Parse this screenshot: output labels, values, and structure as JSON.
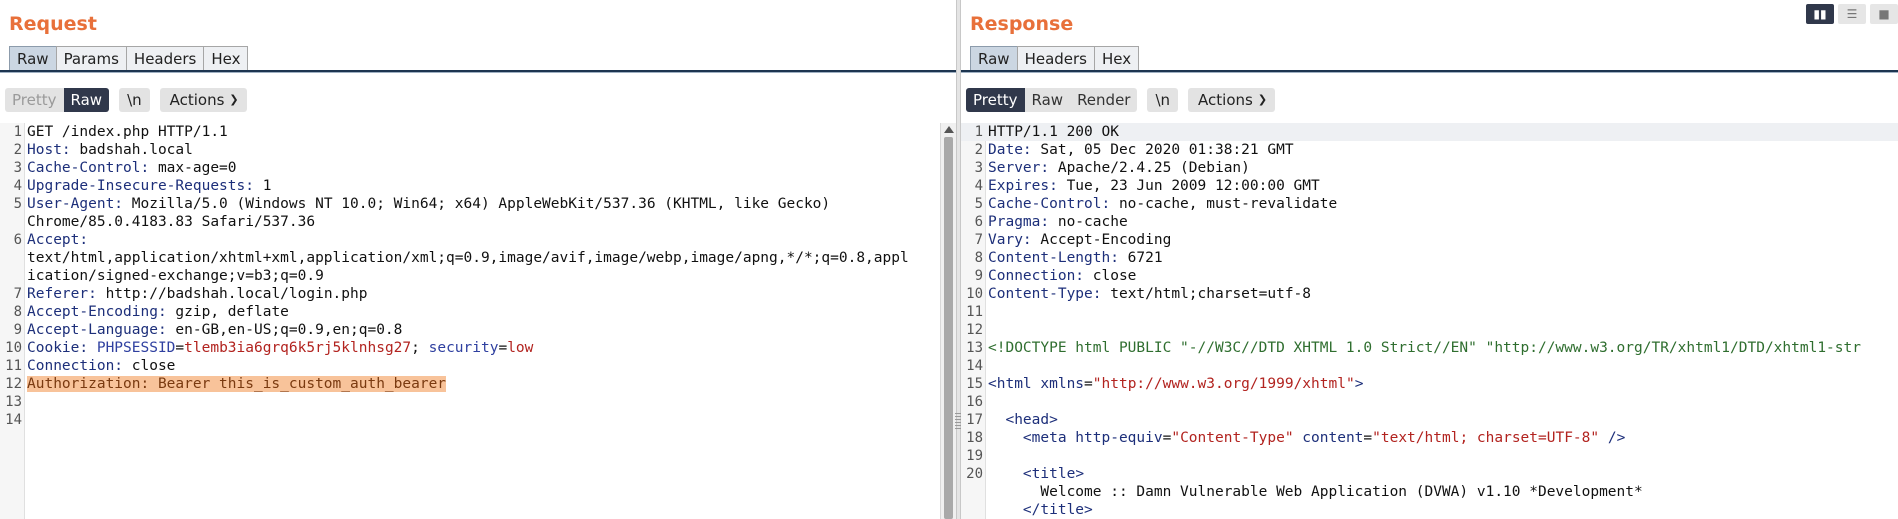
{
  "request": {
    "title": "Request",
    "tabs": [
      "Raw",
      "Params",
      "Headers",
      "Hex"
    ],
    "active_tab": "Raw",
    "view_modes": [
      "Pretty",
      "Raw"
    ],
    "newline_label": "\\n",
    "actions_label": "Actions",
    "lines": [
      {
        "n": "1",
        "a": "GET /index.php HTTP/1.1"
      },
      {
        "n": "2",
        "k": "Host:",
        "v": " badshah.local"
      },
      {
        "n": "3",
        "k": "Cache-Control:",
        "v": " max-age=0"
      },
      {
        "n": "4",
        "k": "Upgrade-Insecure-Requests:",
        "v": " 1"
      },
      {
        "n": "5",
        "k": "User-Agent:",
        "v": " Mozilla/5.0 (Windows NT 10.0; Win64; x64) AppleWebKit/537.36 (KHTML, like Gecko)"
      },
      {
        "n": "",
        "a": "Chrome/85.0.4183.83 Safari/537.36"
      },
      {
        "n": "6",
        "k": "Accept:",
        "v": ""
      },
      {
        "n": "",
        "a": "text/html,application/xhtml+xml,application/xml;q=0.9,image/avif,image/webp,image/apng,*/*;q=0.8,appl"
      },
      {
        "n": "",
        "a": "ication/signed-exchange;v=b3;q=0.9"
      },
      {
        "n": "7",
        "k": "Referer:",
        "v": " http://badshah.local/login.php"
      },
      {
        "n": "8",
        "k": "Accept-Encoding:",
        "v": " gzip, deflate"
      },
      {
        "n": "9",
        "k": "Accept-Language:",
        "v": " en-GB,en-US;q=0.9,en;q=0.8"
      },
      {
        "n": "10",
        "k": "Cookie:",
        "c1k": " PHPSESSID",
        "eq1": "=",
        "c1v": "tlemb3ia6grq6k5rj5klnhsg27",
        "sep": "; ",
        "c2k": "security",
        "eq2": "=",
        "c2v": "low"
      },
      {
        "n": "11",
        "k": "Connection:",
        "v": " close"
      },
      {
        "n": "12",
        "h": "Authorization: Bearer this_is_custom_auth_bearer"
      },
      {
        "n": "13",
        "a": ""
      },
      {
        "n": "14",
        "a": ""
      }
    ]
  },
  "response": {
    "title": "Response",
    "tabs": [
      "Raw",
      "Headers",
      "Hex"
    ],
    "active_tab": "Raw",
    "view_modes": [
      "Pretty",
      "Raw",
      "Render"
    ],
    "newline_label": "\\n",
    "actions_label": "Actions",
    "lines": [
      {
        "n": "1",
        "a": "HTTP/1.1 200 OK"
      },
      {
        "n": "2",
        "k": "Date:",
        "v": " Sat, 05 Dec 2020 01:38:21 GMT"
      },
      {
        "n": "3",
        "k": "Server:",
        "v": " Apache/2.4.25 (Debian)"
      },
      {
        "n": "4",
        "k": "Expires:",
        "v": " Tue, 23 Jun 2009 12:00:00 GMT"
      },
      {
        "n": "5",
        "k": "Cache-Control:",
        "v": " no-cache, must-revalidate"
      },
      {
        "n": "6",
        "k": "Pragma:",
        "v": " no-cache"
      },
      {
        "n": "7",
        "k": "Vary:",
        "v": " Accept-Encoding"
      },
      {
        "n": "8",
        "k": "Content-Length:",
        "v": " 6721"
      },
      {
        "n": "9",
        "k": "Connection:",
        "v": " close"
      },
      {
        "n": "10",
        "k": "Content-Type:",
        "v": " text/html;charset=utf-8"
      },
      {
        "n": "11",
        "a": ""
      },
      {
        "n": "12",
        "a": ""
      },
      {
        "n": "13",
        "d": "<!DOCTYPE html PUBLIC \"-//W3C//DTD XHTML 1.0 Strict//EN\" \"http://www.w3.org/TR/xhtml1/DTD/xhtml1-str"
      },
      {
        "n": "14",
        "a": ""
      },
      {
        "n": "15",
        "t1": "<html",
        "at": " xmlns",
        "eqs": "=",
        "s": "\"http://www.w3.org/1999/xhtml\"",
        "t2": ">"
      },
      {
        "n": "16",
        "a": ""
      },
      {
        "n": "17",
        "t1": "  <head",
        "t2": ">"
      },
      {
        "n": "18",
        "t1": "    <meta",
        "at": " http-equiv",
        "eqs": "=",
        "s": "\"Content-Type\"",
        "at2": " content",
        "eqs2": "=",
        "s2": "\"text/html; charset=UTF-8\"",
        "t2": " />"
      },
      {
        "n": "19",
        "a": ""
      },
      {
        "n": "20",
        "t1": "    <title",
        "t2": ">"
      },
      {
        "n": "",
        "a": "      Welcome :: Damn Vulnerable Web Application (DVWA) v1.10 *Development*"
      },
      {
        "n": "",
        "t1": "    </title",
        "t2": ">"
      }
    ]
  }
}
